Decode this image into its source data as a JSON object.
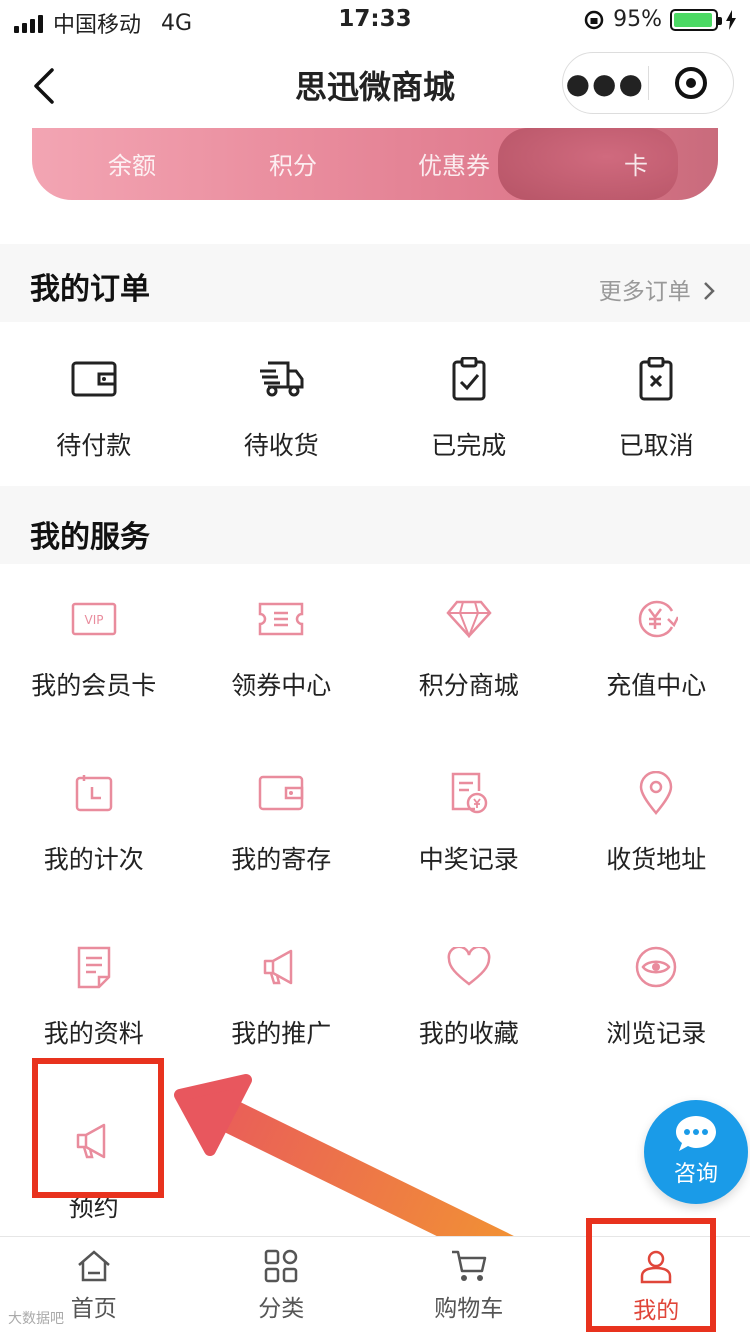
{
  "status_bar": {
    "carrier": "中国移动",
    "network": "4G",
    "time": "17:33",
    "battery_percent": "95%",
    "battery_level": 0.95
  },
  "nav": {
    "title": "思迅微商城"
  },
  "banner": {
    "tabs": [
      "余额",
      "积分",
      "优惠券",
      "卡"
    ]
  },
  "orders": {
    "title": "我的订单",
    "more": "更多订单",
    "items": [
      {
        "label": "待付款",
        "icon": "wallet-icon"
      },
      {
        "label": "待收货",
        "icon": "truck-icon"
      },
      {
        "label": "已完成",
        "icon": "clipboard-check-icon"
      },
      {
        "label": "已取消",
        "icon": "clipboard-x-icon"
      }
    ]
  },
  "services": {
    "title": "我的服务",
    "items": [
      {
        "label": "我的会员卡",
        "icon": "vip-card-icon"
      },
      {
        "label": "领券中心",
        "icon": "coupon-icon"
      },
      {
        "label": "积分商城",
        "icon": "diamond-icon"
      },
      {
        "label": "充值中心",
        "icon": "yen-recharge-icon"
      },
      {
        "label": "我的计次",
        "icon": "clock-card-icon"
      },
      {
        "label": "我的寄存",
        "icon": "wallet-icon"
      },
      {
        "label": "中奖记录",
        "icon": "prize-record-icon"
      },
      {
        "label": "收货地址",
        "icon": "location-pin-icon"
      },
      {
        "label": "我的资料",
        "icon": "document-icon"
      },
      {
        "label": "我的推广",
        "icon": "megaphone-icon"
      },
      {
        "label": "我的收藏",
        "icon": "heart-icon"
      },
      {
        "label": "浏览记录",
        "icon": "eye-icon"
      },
      {
        "label": "预约",
        "icon": "megaphone-icon"
      }
    ]
  },
  "consult": {
    "label": "咨询",
    "icon": "chat-bubble-icon"
  },
  "tabbar": {
    "items": [
      {
        "label": "首页",
        "icon": "home-icon"
      },
      {
        "label": "分类",
        "icon": "category-grid-icon"
      },
      {
        "label": "购物车",
        "icon": "cart-icon"
      },
      {
        "label": "我的",
        "icon": "user-icon"
      }
    ]
  },
  "watermark": "大数据吧",
  "colors": {
    "accent_pink": "#e98c9d",
    "active_red": "#e0463a",
    "highlight_red": "#e8321e",
    "consult_blue": "#1a9be8"
  }
}
